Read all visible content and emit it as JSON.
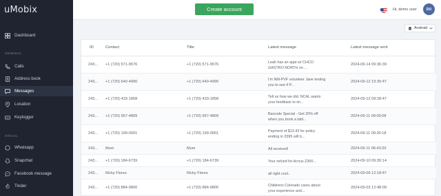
{
  "app": {
    "logo": "uMobix"
  },
  "sidebar": {
    "dashboard": "Dashboard",
    "general_label": "GENERAL",
    "items": [
      {
        "label": "Calls",
        "icon": "phone-icon"
      },
      {
        "label": "Address book",
        "icon": "address-book-icon"
      },
      {
        "label": "Messages",
        "icon": "messages-icon",
        "active": true
      },
      {
        "label": "Location",
        "icon": "location-pin-icon"
      },
      {
        "label": "Keylogger",
        "icon": "keyboard-icon"
      }
    ],
    "social_label": "SOCIAL",
    "social_items": [
      {
        "label": "Whatsapp",
        "icon": "whatsapp-icon"
      },
      {
        "label": "Snapchat",
        "icon": "snapchat-icon"
      },
      {
        "label": "Facebook message",
        "icon": "facebook-messenger-icon"
      },
      {
        "label": "Tinder",
        "icon": "tinder-flame-icon"
      }
    ]
  },
  "topbar": {
    "create_label": "Create account",
    "greeting": "Hi, demo user",
    "avatar_initials": "DU",
    "accent": "#3aa55c"
  },
  "platform": {
    "selected": "Android"
  },
  "table": {
    "headers": {
      "id": "ID",
      "contact": "Contact",
      "title": "Title",
      "latest": "Latest message",
      "sent": "Latest message sent"
    },
    "rows": [
      {
        "id": "243...",
        "contact": "+1 (720) 571-9576",
        "title": "+1 (720) 571-9576",
        "msg1": "Leah has an appt w/ CHCO",
        "msg2": "GASTRO NORTH on ...",
        "sent": "2024-09-14 09:36:39"
      },
      {
        "id": "243...",
        "contact": "+1 (720) 640-4990",
        "title": "+1 (720) 640-4990",
        "msg1": "I'm NM-PVF volunteer Jane texting",
        "msg2": "you to see if P...",
        "sent": "2024-09-12 19:30:47"
      },
      {
        "id": "243...",
        "contact": "+1 (720) 433-1858",
        "title": "+1 (720) 433-1858",
        "msg1": "Tell us how we did. NCAL wants",
        "msg2": "your feedback to im...",
        "sent": "2024-09-12 09:28:47"
      },
      {
        "id": "243...",
        "contact": "+1 (720) 957-4809",
        "title": "+1 (720) 957-4809",
        "msg1": "Barcode Special - Get 20% off",
        "msg2": "when you book a tabl...",
        "sent": "2024-09-11 09:09:08"
      },
      {
        "id": "243...",
        "contact": "+1 (720) 199-0001",
        "title": "+1 (720) 199-0001",
        "msg1": "Payment of $13.43 for policy",
        "msg2": "ending in 3395 will b...",
        "sent": "2024-09-11 09:30:18"
      },
      {
        "id": "243...",
        "contact": "Mum",
        "title": "Mum",
        "msg1": "All received!",
        "msg2": "",
        "sent": "2024-09-11 06:43:20"
      },
      {
        "id": "243...",
        "contact": "+1 (720) 184-6739",
        "title": "+1 (720) 184-6739",
        "msg1": "Your refund for Acnus Z300...",
        "msg2": "",
        "sent": "2024-09-10 09:30:14"
      },
      {
        "id": "243...",
        "contact": "Ricky Flores",
        "title": "Ricky Flores",
        "msg1": "all right cool..",
        "msg2": "",
        "sent": "2024-09-09 12:18:47"
      },
      {
        "id": "243...",
        "contact": "+1 (720) 884-9800",
        "title": "+1 (720) 884-9800",
        "msg1": "Childrens Colorado cares about",
        "msg2": "your experience and...",
        "sent": "2024-09-03 12:48:09"
      }
    ]
  }
}
